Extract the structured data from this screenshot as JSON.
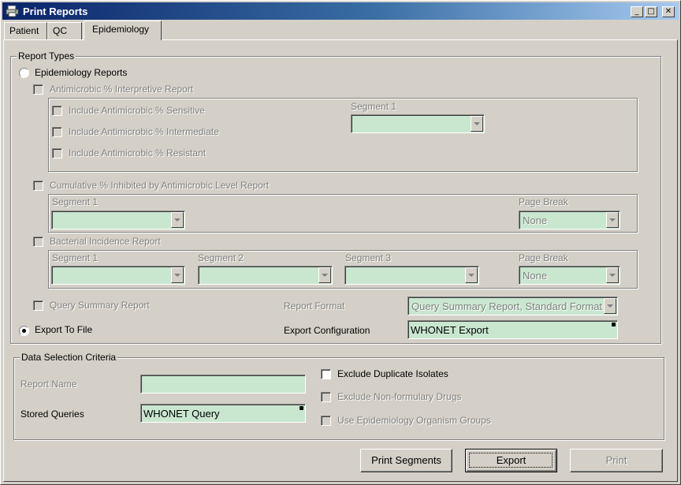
{
  "window": {
    "title": "Print Reports",
    "controls": {
      "minimize": "_",
      "maximize": "□",
      "close": "✕"
    }
  },
  "tabs": [
    {
      "label": "Patient",
      "active": false
    },
    {
      "label": "QC",
      "active": false
    },
    {
      "label": "Epidemiology",
      "active": true
    }
  ],
  "report_types": {
    "legend": "Report Types",
    "epidemiology_radio": {
      "label": "Epidemiology Reports",
      "selected": false
    },
    "antimicrobic": {
      "label": "Antimicrobic % Interpretive Report",
      "checked": false,
      "include_sensitive": "Include Antimicrobic % Sensitive",
      "include_intermediate": "Include Antimicrobic % Intermediate",
      "include_resistant": "Include Antimicrobic % Resistant",
      "segment1_label": "Segment 1",
      "segment1_value": ""
    },
    "cumulative": {
      "label": "Cumulative % Inhibited by Antimicrobic Level Report",
      "checked": false,
      "segment1_label": "Segment 1",
      "segment1_value": "",
      "page_break_label": "Page Break",
      "page_break_value": "None"
    },
    "bacterial": {
      "label": "Bacterial Incidence Report",
      "checked": false,
      "segment1_label": "Segment 1",
      "segment2_label": "Segment 2",
      "segment3_label": "Segment 3",
      "segment1_value": "",
      "segment2_value": "",
      "segment3_value": "",
      "page_break_label": "Page Break",
      "page_break_value": "None"
    },
    "query_summary": {
      "label": "Query Summary Report",
      "checked": false,
      "format_label": "Report Format",
      "format_value": "Query Summary Report, Standard Format"
    },
    "export_radio": {
      "label": "Export To File",
      "selected": true
    },
    "export_config": {
      "label": "Export Configuration",
      "value": "WHONET Export"
    }
  },
  "data_selection": {
    "legend": "Data Selection Criteria",
    "report_name_label": "Report Name",
    "report_name_value": "",
    "stored_queries_label": "Stored Queries",
    "stored_queries_value": "WHONET Query",
    "exclude_duplicates": "Exclude Duplicate Isolates",
    "exclude_nonformulary": "Exclude Non-formulary Drugs",
    "use_epi_groups": "Use Epidemiology Organism Groups"
  },
  "buttons": {
    "print_segments": "Print Segments",
    "export": "Export",
    "print": "Print"
  },
  "colors": {
    "face": "#d4d0c8",
    "field": "#c9e7cf",
    "title_start": "#0a246a",
    "title_end": "#a6caf0",
    "disabled_text": "#808080"
  }
}
